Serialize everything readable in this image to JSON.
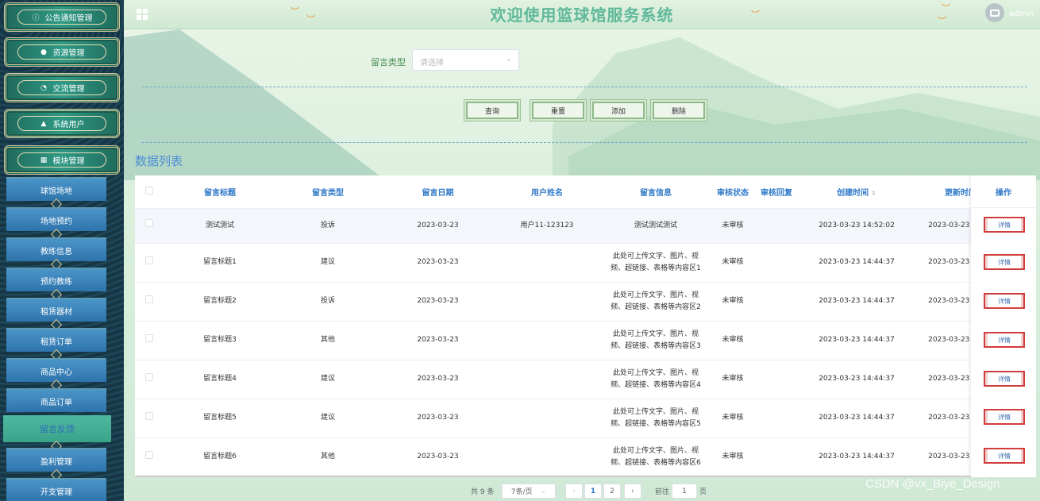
{
  "header": {
    "title": "欢迎使用篮球馆服务系统",
    "user": "admin"
  },
  "sidebar": {
    "top_menus": [
      {
        "icon": "info-circle-icon",
        "glyph": "ⓘ",
        "label": "公告通知管理"
      },
      {
        "icon": "pin-icon",
        "glyph": "●",
        "label": "资源管理"
      },
      {
        "icon": "chat-icon",
        "glyph": "◔",
        "label": "交流管理"
      },
      {
        "icon": "user-icon",
        "glyph": "▲",
        "label": "系统用户"
      },
      {
        "icon": "grid-icon",
        "glyph": "▦",
        "label": "模块管理"
      }
    ],
    "sub_menus": [
      {
        "label": "球馆场地"
      },
      {
        "label": "场地预约"
      },
      {
        "label": "教练信息"
      },
      {
        "label": "预约教练"
      },
      {
        "label": "租赁器材"
      },
      {
        "label": "租赁订单"
      },
      {
        "label": "商品中心"
      },
      {
        "label": "商品订单"
      },
      {
        "label": "留言反馈",
        "active": true
      },
      {
        "label": "盈利管理"
      },
      {
        "label": "开支管理"
      }
    ]
  },
  "filter": {
    "label": "留言类型",
    "placeholder": "请选择"
  },
  "buttons": {
    "query": "查询",
    "reset": "重置",
    "add": "添加",
    "delete": "删除"
  },
  "section_title": "数据列表",
  "table": {
    "columns": [
      "留言标题",
      "留言类型",
      "留言日期",
      "用户姓名",
      "留言信息",
      "审核状态",
      "审核回复",
      "创建时间",
      "更新时间"
    ],
    "ops_header": "操作",
    "detail_label": "详情",
    "rows": [
      {
        "title": "测试测试",
        "type": "投诉",
        "date": "2023-03-23",
        "user": "用户11-123123",
        "info1": "测试测试测试",
        "info2": "",
        "status": "未审核",
        "reply": "",
        "created": "2023-03-23 14:52:02",
        "updated": "2023-03-23 1"
      },
      {
        "title": "留言标题1",
        "type": "建议",
        "date": "2023-03-23",
        "user": "",
        "info1": "此处可上传文字、图片、视",
        "info2": "频、超链接、表格等内容区1",
        "status": "未审核",
        "reply": "",
        "created": "2023-03-23 14:44:37",
        "updated": "2023-03-23 1"
      },
      {
        "title": "留言标题2",
        "type": "投诉",
        "date": "2023-03-23",
        "user": "",
        "info1": "此处可上传文字、图片、视",
        "info2": "频、超链接、表格等内容区2",
        "status": "未审核",
        "reply": "",
        "created": "2023-03-23 14:44:37",
        "updated": "2023-03-23 1"
      },
      {
        "title": "留言标题3",
        "type": "其他",
        "date": "2023-03-23",
        "user": "",
        "info1": "此处可上传文字、图片、视",
        "info2": "频、超链接、表格等内容区3",
        "status": "未审核",
        "reply": "",
        "created": "2023-03-23 14:44:37",
        "updated": "2023-03-23 1"
      },
      {
        "title": "留言标题4",
        "type": "建议",
        "date": "2023-03-23",
        "user": "",
        "info1": "此处可上传文字、图片、视",
        "info2": "频、超链接、表格等内容区4",
        "status": "未审核",
        "reply": "",
        "created": "2023-03-23 14:44:37",
        "updated": "2023-03-23 1"
      },
      {
        "title": "留言标题5",
        "type": "建议",
        "date": "2023-03-23",
        "user": "",
        "info1": "此处可上传文字、图片、视",
        "info2": "频、超链接、表格等内容区5",
        "status": "未审核",
        "reply": "",
        "created": "2023-03-23 14:44:37",
        "updated": "2023-03-23 1"
      },
      {
        "title": "留言标题6",
        "type": "其他",
        "date": "2023-03-23",
        "user": "",
        "info1": "此处可上传文字、图片、视",
        "info2": "频、超链接、表格等内容区6",
        "status": "未审核",
        "reply": "",
        "created": "2023-03-23 14:44:37",
        "updated": "2023-03-23 1"
      }
    ]
  },
  "pagination": {
    "total": "共 9 条",
    "page_size": "7条/页",
    "pages": [
      "1",
      "2"
    ],
    "current": "1",
    "goto_label": "前往",
    "goto_value": "1",
    "page_suffix": "页"
  },
  "watermark": "CSDN @vx_Biye_Design"
}
